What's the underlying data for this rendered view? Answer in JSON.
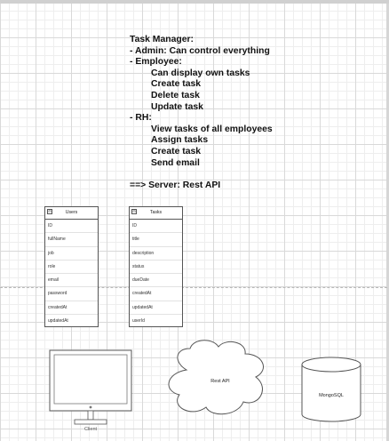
{
  "notes": {
    "lines": [
      {
        "text": "Task Manager:",
        "indent": 0
      },
      {
        "text": "- Admin: Can control everything",
        "indent": 0
      },
      {
        "text": "- Employee:",
        "indent": 0
      },
      {
        "text": "Can display own tasks",
        "indent": 1
      },
      {
        "text": "Create task",
        "indent": 1
      },
      {
        "text": "Delete  task",
        "indent": 1
      },
      {
        "text": "Update task",
        "indent": 1
      },
      {
        "text": "- RH:",
        "indent": 0
      },
      {
        "text": "View tasks of all employees",
        "indent": 1
      },
      {
        "text": "Assign tasks",
        "indent": 1
      },
      {
        "text": "Create task",
        "indent": 1
      },
      {
        "text": "Send email",
        "indent": 1
      },
      {
        "text": "",
        "indent": 0
      },
      {
        "text": "==> Server: Rest API",
        "indent": 0
      }
    ]
  },
  "tables": {
    "users": {
      "title": "Users",
      "fields": [
        "ID",
        "fullName",
        "job",
        "role",
        "email",
        "password",
        "createdAt",
        "updatedAt"
      ]
    },
    "tasks": {
      "title": "Tasks",
      "fields": [
        "ID",
        "title",
        "description",
        "status",
        "dueDate",
        "createdAt",
        "updatedAt",
        "userId"
      ]
    },
    "collapse_glyph": "⊟"
  },
  "shapes": {
    "client_label": "Client",
    "cloud_label": "Rest API",
    "db_label": "MongoSQL"
  },
  "colors": {
    "stroke": "#555555",
    "grid_major": "#d9d9d9",
    "grid_minor": "#eeeeee",
    "text": "#111111"
  }
}
